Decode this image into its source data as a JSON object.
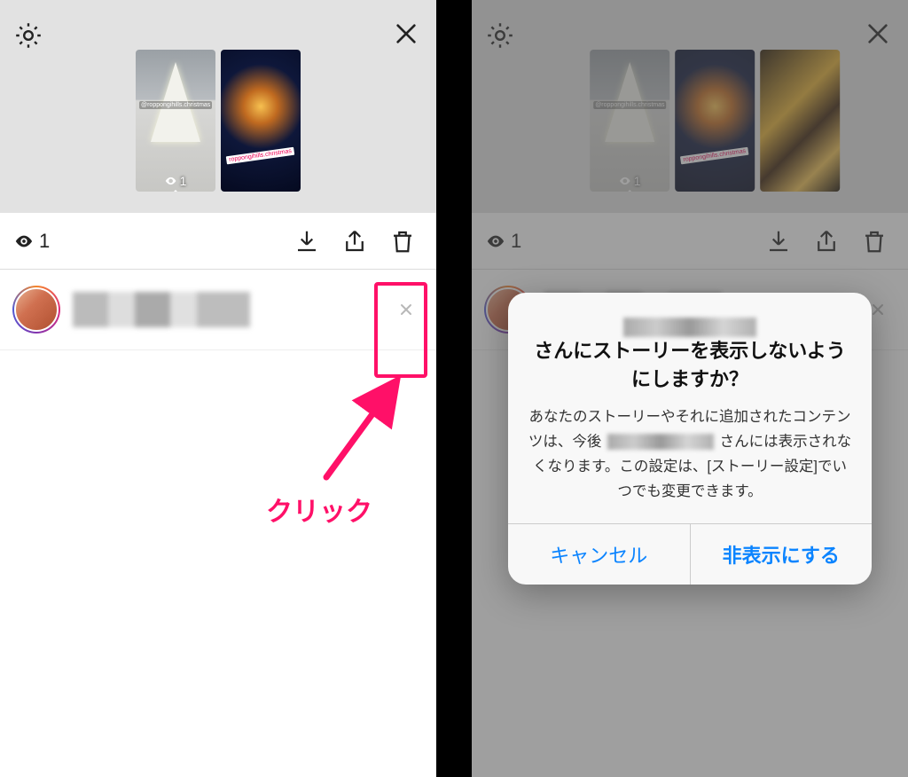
{
  "left": {
    "view_count": "1",
    "thumbs": [
      {
        "tag": "@roppongihills.christmas",
        "views": "1",
        "selected": true
      },
      {
        "tag": "roppongihills.christmas",
        "selected": false
      }
    ],
    "annotation": {
      "label": "クリック"
    }
  },
  "right": {
    "view_count": "1",
    "thumbs": [
      {
        "tag": "@roppongihills.christmas",
        "views": "1",
        "selected": true
      },
      {
        "tag": "roppongihills.christmas",
        "selected": false
      },
      {
        "selected": false
      }
    ],
    "dialog": {
      "title_suffix": "さんにストーリーを表示しないようにしますか？",
      "msg_1": "あなたのストーリーやそれに追加されたコンテンツは、今後",
      "msg_2": "さんには表示されなくなります。この設定は、[ストーリー設定]でいつでも変更できます。",
      "cancel": "キャンセル",
      "confirm": "非表示にする"
    }
  }
}
